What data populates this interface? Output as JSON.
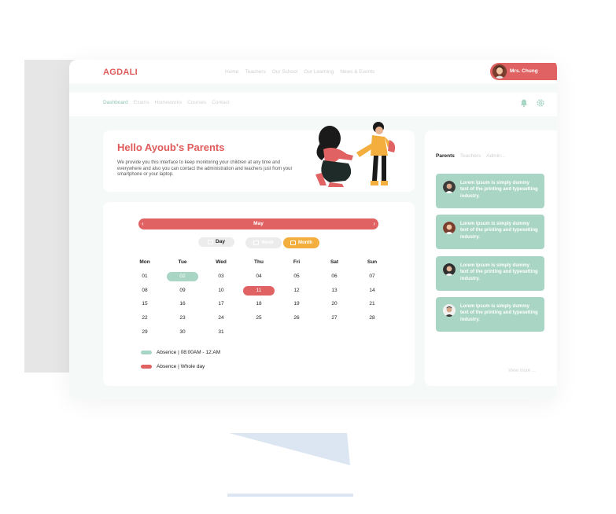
{
  "header": {
    "logo": "AGDALI",
    "nav": [
      "Home",
      "Teachers",
      "Our School",
      "Our Learning",
      "News & Events"
    ],
    "user_name": "Mrs. Chung"
  },
  "subnav": {
    "items": [
      "Dashboard",
      "Exams",
      "Homeworks",
      "Courses",
      "Contact"
    ],
    "active": "Dashboard"
  },
  "hello": {
    "title": "Hello Ayoub's Parents",
    "text": "We provide you this interface to keep monitoring your children at any time and everywhere and also you can contact the administration and teachers just from your smartphone or your laptop."
  },
  "calendar": {
    "month": "May",
    "prev_icon": "chevron-left-icon",
    "next_icon": "chevron-right-icon",
    "views": [
      "Day",
      "Week",
      "Month"
    ],
    "active_view": "Month",
    "weekdays": [
      "Mon",
      "Tue",
      "Wed",
      "Thu",
      "Fri",
      "Sat",
      "Sun"
    ],
    "weeks": [
      [
        "01",
        "02",
        "03",
        "04",
        "05",
        "06",
        "07"
      ],
      [
        "08",
        "09",
        "10",
        "11",
        "12",
        "13",
        "14"
      ],
      [
        "15",
        "16",
        "17",
        "18",
        "19",
        "20",
        "21"
      ],
      [
        "22",
        "23",
        "24",
        "25",
        "26",
        "27",
        "28"
      ],
      [
        "29",
        "30",
        "31",
        "",
        "",
        "",
        ""
      ]
    ],
    "partial_absence_day": "02",
    "full_absence_day": "11",
    "legend": [
      {
        "label": "Absence | 08:00AM - 12:AM",
        "color": "#a9d5c4"
      },
      {
        "label": "Absence | Whole day",
        "color": "#e06263"
      }
    ]
  },
  "sidebar": {
    "tabs": [
      "Parents",
      "Teachers",
      "Admin..."
    ],
    "active_tab": "Parents",
    "messages": [
      "Lorem Ipsum is simply dummy text of the printing and typesetting industry.",
      "Lorem Ipsum is simply dummy text of the printing and typesetting industry.",
      "Lorem Ipsum is simply dummy text of the printing and typesetting industry.",
      "Lorem Ipsum is simply dummy text of the printing and typesetting industry."
    ],
    "view_more": "View more ..."
  },
  "colors": {
    "brand": "#e05a5a",
    "accent_red": "#e06263",
    "accent_mint": "#a9d5c4",
    "accent_orange": "#f3ae3d"
  },
  "icons": {
    "notification": "bell-icon",
    "settings": "gear-icon",
    "view_button": "calendar-icon"
  }
}
